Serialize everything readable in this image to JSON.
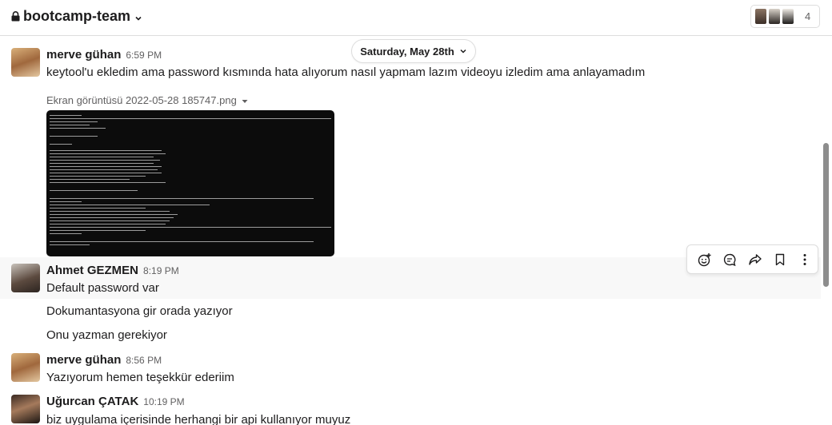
{
  "header": {
    "channel_name": "bootcamp-team",
    "member_count": "4"
  },
  "date_divider": {
    "label": "Saturday, May 28th"
  },
  "messages": [
    {
      "author": "merve gühan",
      "time": "6:59 PM",
      "text": "keytool'u ekledim ama password kısmında hata alıyorum nasıl yapmam lazım videoyu izledim ama anlayamadım",
      "file_name": "Ekran görüntüsü 2022-05-28 185747.png"
    },
    {
      "author": "Ahmet GEZMEN",
      "time": "8:19 PM",
      "text": "Default password var",
      "followups": [
        "Dokumantasyona gir orada yazıyor",
        "Onu yazman gerekiyor"
      ]
    },
    {
      "author": "merve gühan",
      "time": "8:56 PM",
      "text": "Yazıyorum hemen teşekkür ederiim"
    },
    {
      "author": "Uğurcan ÇATAK",
      "time": "10:19 PM",
      "text": "biz uygulama içerisinde herhangi bir api kullanıyor muyuz"
    }
  ],
  "actions": {
    "icons": [
      "add-reaction-icon",
      "reply-in-thread-icon",
      "share-message-icon",
      "save-bookmark-icon",
      "more-actions-icon"
    ]
  },
  "colors": {
    "text": "#1d1c1d",
    "muted": "#616061",
    "border": "#dddddd",
    "hover_row": "#f8f8f8"
  }
}
